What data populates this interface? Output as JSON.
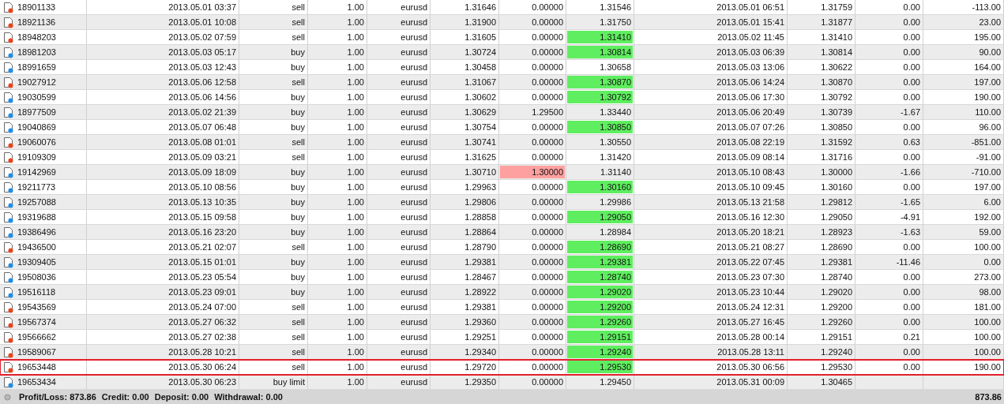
{
  "rows": [
    {
      "order": "18901133",
      "open_time": "2013.05.01 03:37",
      "type": "sell",
      "size": "1.00",
      "symbol": "eurusd",
      "open_price": "1.31646",
      "sl": "0.00000",
      "tp": "1.31546",
      "close_time": "2013.05.01 06:51",
      "close_price": "1.31759",
      "swap": "0.00",
      "profit": "-113.00",
      "color": "#e8441c",
      "tp_hit": false,
      "sl_hit": false,
      "outlined": false
    },
    {
      "order": "18921136",
      "open_time": "2013.05.01 10:08",
      "type": "sell",
      "size": "1.00",
      "symbol": "eurusd",
      "open_price": "1.31900",
      "sl": "0.00000",
      "tp": "1.31750",
      "close_time": "2013.05.01 15:41",
      "close_price": "1.31877",
      "swap": "0.00",
      "profit": "23.00",
      "color": "#e8441c",
      "tp_hit": false,
      "sl_hit": false,
      "outlined": false
    },
    {
      "order": "18948203",
      "open_time": "2013.05.02 07:59",
      "type": "sell",
      "size": "1.00",
      "symbol": "eurusd",
      "open_price": "1.31605",
      "sl": "0.00000",
      "tp": "1.31410",
      "close_time": "2013.05.02 11:45",
      "close_price": "1.31410",
      "swap": "0.00",
      "profit": "195.00",
      "color": "#e8441c",
      "tp_hit": true,
      "sl_hit": false,
      "outlined": false
    },
    {
      "order": "18981203",
      "open_time": "2013.05.03 05:17",
      "type": "buy",
      "size": "1.00",
      "symbol": "eurusd",
      "open_price": "1.30724",
      "sl": "0.00000",
      "tp": "1.30814",
      "close_time": "2013.05.03 06:39",
      "close_price": "1.30814",
      "swap": "0.00",
      "profit": "90.00",
      "color": "#1e8ee8",
      "tp_hit": true,
      "sl_hit": false,
      "outlined": false
    },
    {
      "order": "18991659",
      "open_time": "2013.05.03 12:43",
      "type": "buy",
      "size": "1.00",
      "symbol": "eurusd",
      "open_price": "1.30458",
      "sl": "0.00000",
      "tp": "1.30658",
      "close_time": "2013.05.03 13:06",
      "close_price": "1.30622",
      "swap": "0.00",
      "profit": "164.00",
      "color": "#1e8ee8",
      "tp_hit": false,
      "sl_hit": false,
      "outlined": false
    },
    {
      "order": "19027912",
      "open_time": "2013.05.06 12:58",
      "type": "sell",
      "size": "1.00",
      "symbol": "eurusd",
      "open_price": "1.31067",
      "sl": "0.00000",
      "tp": "1.30870",
      "close_time": "2013.05.06 14:24",
      "close_price": "1.30870",
      "swap": "0.00",
      "profit": "197.00",
      "color": "#e8441c",
      "tp_hit": true,
      "sl_hit": false,
      "outlined": false
    },
    {
      "order": "19030599",
      "open_time": "2013.05.06 14:56",
      "type": "buy",
      "size": "1.00",
      "symbol": "eurusd",
      "open_price": "1.30602",
      "sl": "0.00000",
      "tp": "1.30792",
      "close_time": "2013.05.06 17:30",
      "close_price": "1.30792",
      "swap": "0.00",
      "profit": "190.00",
      "color": "#1e8ee8",
      "tp_hit": true,
      "sl_hit": false,
      "outlined": false
    },
    {
      "order": "18977509",
      "open_time": "2013.05.02 21:39",
      "type": "buy",
      "size": "1.00",
      "symbol": "eurusd",
      "open_price": "1.30629",
      "sl": "1.29500",
      "tp": "1.33440",
      "close_time": "2013.05.06 20:49",
      "close_price": "1.30739",
      "swap": "-1.67",
      "profit": "110.00",
      "color": "#1e8ee8",
      "tp_hit": false,
      "sl_hit": false,
      "outlined": false
    },
    {
      "order": "19040869",
      "open_time": "2013.05.07 06:48",
      "type": "buy",
      "size": "1.00",
      "symbol": "eurusd",
      "open_price": "1.30754",
      "sl": "0.00000",
      "tp": "1.30850",
      "close_time": "2013.05.07 07:26",
      "close_price": "1.30850",
      "swap": "0.00",
      "profit": "96.00",
      "color": "#1e8ee8",
      "tp_hit": true,
      "sl_hit": false,
      "outlined": false
    },
    {
      "order": "19060076",
      "open_time": "2013.05.08 01:01",
      "type": "sell",
      "size": "1.00",
      "symbol": "eurusd",
      "open_price": "1.30741",
      "sl": "0.00000",
      "tp": "1.30550",
      "close_time": "2013.05.08 22:19",
      "close_price": "1.31592",
      "swap": "0.63",
      "profit": "-851.00",
      "color": "#e8441c",
      "tp_hit": false,
      "sl_hit": false,
      "outlined": false
    },
    {
      "order": "19109309",
      "open_time": "2013.05.09 03:21",
      "type": "sell",
      "size": "1.00",
      "symbol": "eurusd",
      "open_price": "1.31625",
      "sl": "0.00000",
      "tp": "1.31420",
      "close_time": "2013.05.09 08:14",
      "close_price": "1.31716",
      "swap": "0.00",
      "profit": "-91.00",
      "color": "#e8441c",
      "tp_hit": false,
      "sl_hit": false,
      "outlined": false
    },
    {
      "order": "19142969",
      "open_time": "2013.05.09 18:09",
      "type": "buy",
      "size": "1.00",
      "symbol": "eurusd",
      "open_price": "1.30710",
      "sl": "1.30000",
      "tp": "1.31140",
      "close_time": "2013.05.10 08:43",
      "close_price": "1.30000",
      "swap": "-1.66",
      "profit": "-710.00",
      "color": "#1e8ee8",
      "tp_hit": false,
      "sl_hit": true,
      "outlined": false
    },
    {
      "order": "19211773",
      "open_time": "2013.05.10 08:56",
      "type": "buy",
      "size": "1.00",
      "symbol": "eurusd",
      "open_price": "1.29963",
      "sl": "0.00000",
      "tp": "1.30160",
      "close_time": "2013.05.10 09:45",
      "close_price": "1.30160",
      "swap": "0.00",
      "profit": "197.00",
      "color": "#1e8ee8",
      "tp_hit": true,
      "sl_hit": false,
      "outlined": false
    },
    {
      "order": "19257088",
      "open_time": "2013.05.13 10:35",
      "type": "buy",
      "size": "1.00",
      "symbol": "eurusd",
      "open_price": "1.29806",
      "sl": "0.00000",
      "tp": "1.29986",
      "close_time": "2013.05.13 21:58",
      "close_price": "1.29812",
      "swap": "-1.65",
      "profit": "6.00",
      "color": "#1e8ee8",
      "tp_hit": false,
      "sl_hit": false,
      "outlined": false
    },
    {
      "order": "19319688",
      "open_time": "2013.05.15 09:58",
      "type": "buy",
      "size": "1.00",
      "symbol": "eurusd",
      "open_price": "1.28858",
      "sl": "0.00000",
      "tp": "1.29050",
      "close_time": "2013.05.16 12:30",
      "close_price": "1.29050",
      "swap": "-4.91",
      "profit": "192.00",
      "color": "#1e8ee8",
      "tp_hit": true,
      "sl_hit": false,
      "outlined": false
    },
    {
      "order": "19386496",
      "open_time": "2013.05.16 23:20",
      "type": "buy",
      "size": "1.00",
      "symbol": "eurusd",
      "open_price": "1.28864",
      "sl": "0.00000",
      "tp": "1.28984",
      "close_time": "2013.05.20 18:21",
      "close_price": "1.28923",
      "swap": "-1.63",
      "profit": "59.00",
      "color": "#1e8ee8",
      "tp_hit": false,
      "sl_hit": false,
      "outlined": false
    },
    {
      "order": "19436500",
      "open_time": "2013.05.21 02:07",
      "type": "sell",
      "size": "1.00",
      "symbol": "eurusd",
      "open_price": "1.28790",
      "sl": "0.00000",
      "tp": "1.28690",
      "close_time": "2013.05.21 08:27",
      "close_price": "1.28690",
      "swap": "0.00",
      "profit": "100.00",
      "color": "#e8441c",
      "tp_hit": true,
      "sl_hit": false,
      "outlined": false
    },
    {
      "order": "19309405",
      "open_time": "2013.05.15 01:01",
      "type": "buy",
      "size": "1.00",
      "symbol": "eurusd",
      "open_price": "1.29381",
      "sl": "0.00000",
      "tp": "1.29381",
      "close_time": "2013.05.22 07:45",
      "close_price": "1.29381",
      "swap": "-11.46",
      "profit": "0.00",
      "color": "#1e8ee8",
      "tp_hit": true,
      "sl_hit": false,
      "outlined": false
    },
    {
      "order": "19508036",
      "open_time": "2013.05.23 05:54",
      "type": "buy",
      "size": "1.00",
      "symbol": "eurusd",
      "open_price": "1.28467",
      "sl": "0.00000",
      "tp": "1.28740",
      "close_time": "2013.05.23 07:30",
      "close_price": "1.28740",
      "swap": "0.00",
      "profit": "273.00",
      "color": "#1e8ee8",
      "tp_hit": true,
      "sl_hit": false,
      "outlined": false
    },
    {
      "order": "19516118",
      "open_time": "2013.05.23 09:01",
      "type": "buy",
      "size": "1.00",
      "symbol": "eurusd",
      "open_price": "1.28922",
      "sl": "0.00000",
      "tp": "1.29020",
      "close_time": "2013.05.23 10:44",
      "close_price": "1.29020",
      "swap": "0.00",
      "profit": "98.00",
      "color": "#1e8ee8",
      "tp_hit": true,
      "sl_hit": false,
      "outlined": false
    },
    {
      "order": "19543569",
      "open_time": "2013.05.24 07:00",
      "type": "sell",
      "size": "1.00",
      "symbol": "eurusd",
      "open_price": "1.29381",
      "sl": "0.00000",
      "tp": "1.29200",
      "close_time": "2013.05.24 12:31",
      "close_price": "1.29200",
      "swap": "0.00",
      "profit": "181.00",
      "color": "#e8441c",
      "tp_hit": true,
      "sl_hit": false,
      "outlined": false
    },
    {
      "order": "19567374",
      "open_time": "2013.05.27 06:32",
      "type": "sell",
      "size": "1.00",
      "symbol": "eurusd",
      "open_price": "1.29360",
      "sl": "0.00000",
      "tp": "1.29260",
      "close_time": "2013.05.27 16:45",
      "close_price": "1.29260",
      "swap": "0.00",
      "profit": "100.00",
      "color": "#e8441c",
      "tp_hit": true,
      "sl_hit": false,
      "outlined": false
    },
    {
      "order": "19566662",
      "open_time": "2013.05.27 02:38",
      "type": "sell",
      "size": "1.00",
      "symbol": "eurusd",
      "open_price": "1.29251",
      "sl": "0.00000",
      "tp": "1.29151",
      "close_time": "2013.05.28 00:14",
      "close_price": "1.29151",
      "swap": "0.21",
      "profit": "100.00",
      "color": "#e8441c",
      "tp_hit": true,
      "sl_hit": false,
      "outlined": false
    },
    {
      "order": "19589067",
      "open_time": "2013.05.28 10:21",
      "type": "sell",
      "size": "1.00",
      "symbol": "eurusd",
      "open_price": "1.29340",
      "sl": "0.00000",
      "tp": "1.29240",
      "close_time": "2013.05.28 13:11",
      "close_price": "1.29240",
      "swap": "0.00",
      "profit": "100.00",
      "color": "#e8441c",
      "tp_hit": true,
      "sl_hit": false,
      "outlined": false
    },
    {
      "order": "19653448",
      "open_time": "2013.05.30 06:24",
      "type": "sell",
      "size": "1.00",
      "symbol": "eurusd",
      "open_price": "1.29720",
      "sl": "0.00000",
      "tp": "1.29530",
      "close_time": "2013.05.30 06:56",
      "close_price": "1.29530",
      "swap": "0.00",
      "profit": "190.00",
      "color": "#e8441c",
      "tp_hit": true,
      "sl_hit": false,
      "outlined": true
    },
    {
      "order": "19653434",
      "open_time": "2013.05.30 06:23",
      "type": "buy limit",
      "size": "1.00",
      "symbol": "eurusd",
      "open_price": "1.29350",
      "sl": "0.00000",
      "tp": "1.29450",
      "close_time": "2013.05.31 00:09",
      "close_price": "1.30465",
      "color": "#1e8ee8",
      "tp_hit": false,
      "sl_hit": false,
      "outlined": false
    }
  ],
  "summary": {
    "items": [
      "Profit/Loss: 873.86",
      "Credit: 0.00",
      "Deposit: 0.00",
      "Withdrawal: 0.00"
    ],
    "total": "873.86"
  }
}
